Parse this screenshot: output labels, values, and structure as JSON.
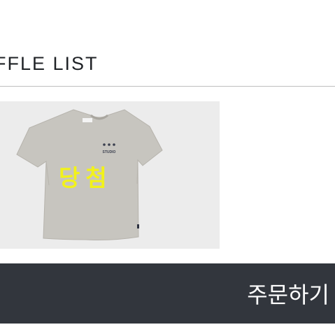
{
  "section": {
    "title": "FFLE LIST"
  },
  "product": {
    "image_icon": "tshirt-product-image",
    "status_badge": "당첨",
    "status_color": "#f2f21a",
    "shirt_brand_text": "STUDIO"
  },
  "order_button": {
    "label": "주문하기",
    "background": "#32363d"
  }
}
